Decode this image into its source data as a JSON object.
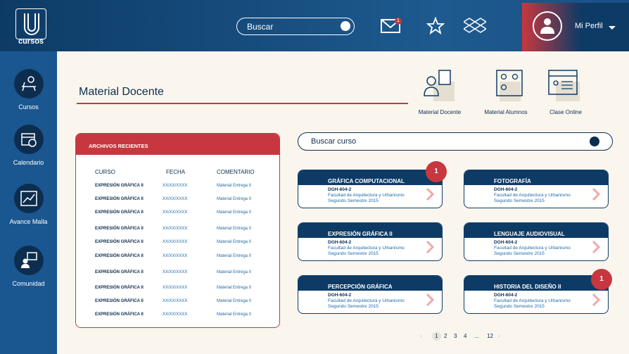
{
  "header": {
    "logo_text": "cursos",
    "search_placeholder": "Buscar",
    "mail_badge": "1",
    "profile_label": "Mi Perfil"
  },
  "sidebar": {
    "items": [
      {
        "label": "Cursos",
        "icon": "desk-clock-icon"
      },
      {
        "label": "Calendario",
        "icon": "calendar-icon"
      },
      {
        "label": "Avance Malla",
        "icon": "chart-line-icon"
      },
      {
        "label": "Comunidad",
        "icon": "chat-user-icon"
      }
    ]
  },
  "page": {
    "title": "Material Docente"
  },
  "quick_links": [
    {
      "label": "Material Docente",
      "icon": "teacher-icon"
    },
    {
      "label": "Material Alumnos",
      "icon": "students-icon"
    },
    {
      "label": "Clase Online",
      "icon": "online-class-icon"
    }
  ],
  "recent_files": {
    "title": "ARCHIVOS RECIENTES",
    "columns": [
      "CURSO",
      "FECHA",
      "COMENTARIO"
    ],
    "rows": [
      {
        "curso": "EXPRESIÓN GRÁFICA II",
        "fecha": "XX/XX/XXXX",
        "comentario": "Material Entrega II"
      },
      {
        "curso": "EXPRESIÓN GRÁFICA II",
        "fecha": "XX/XX/XXXX",
        "comentario": "Material Entrega II"
      },
      {
        "curso": "EXPRESIÓN GRÁFICA II",
        "fecha": "XX/XX/XXXX",
        "comentario": "Material Entrega II"
      },
      {
        "curso": "EXPRESIÓN GRÁFICA II",
        "fecha": "XX/XX/XXXX",
        "comentario": "Material Entrega II"
      },
      {
        "curso": "EXPRESIÓN GRÁFICA II",
        "fecha": "XX/XX/XXXX",
        "comentario": "Material Entrega II"
      },
      {
        "curso": "EXPRESIÓN GRÁFICA II",
        "fecha": "XX/XX/XXXX",
        "comentario": "Material Entrega II"
      },
      {
        "curso": "EXPRESIÓN GRÁFICA II",
        "fecha": "XX/XX/XXXX",
        "comentario": "Material Entrega II"
      },
      {
        "curso": "EXPRESIÓN GRÁFICA II",
        "fecha": "XX/XX/XXXX",
        "comentario": "Material Entrega II"
      },
      {
        "curso": "EXPRESIÓN GRÁFICA II",
        "fecha": "XX/XX/XXXX",
        "comentario": "Material Entrega II"
      },
      {
        "curso": "EXPRESIÓN GRÁFICA II",
        "fecha": "XX/XX/XXXX",
        "comentario": "Material Entrega II"
      }
    ]
  },
  "course_search": {
    "placeholder": "Buscar curso"
  },
  "courses": [
    {
      "name": "GRÁFICA COMPUTACIONAL",
      "code": "DGH-604-2",
      "faculty": "Facultad de Arquitectura y Urbanismo",
      "semester": "Segundo Semestre 2015",
      "badge": "1"
    },
    {
      "name": "FOTOGRAFÍA",
      "code": "DGH-604-2",
      "faculty": "Facultad de Arquitectura y Urbanismo",
      "semester": "Segundo Semestre 2015",
      "badge": ""
    },
    {
      "name": "EXPRESIÓN GRÁFICA II",
      "code": "DGH-604-2",
      "faculty": "Facultad de Arquitectura y Urbanismo",
      "semester": "Segundo Semestre 2015",
      "badge": ""
    },
    {
      "name": "LENGUAJE AUDIOVISUAL",
      "code": "DGH-604-2",
      "faculty": "Facultad de Arquitectura y Urbanismo",
      "semester": "Segundo Semestre 2015",
      "badge": ""
    },
    {
      "name": "PERCEPCIÓN GRÁFICA",
      "code": "DGH-604-2",
      "faculty": "Facultad de Arquitectura y Urbanismo",
      "semester": "Segundo Semestre 2015",
      "badge": ""
    },
    {
      "name": "HISTORIA DEL DISEÑO II",
      "code": "DGH-604-2",
      "faculty": "Facultad de Arquitectura y Urbanismo",
      "semester": "Segundo Semestre 2015",
      "badge": "1"
    }
  ],
  "pagination": {
    "prev": "‹",
    "pages": [
      "1",
      "2",
      "3",
      "4",
      "...",
      "12"
    ],
    "next": "›",
    "current": "1"
  },
  "colors": {
    "primary": "#0d3b66",
    "accent": "#c8373f",
    "background": "#faf6ee"
  }
}
